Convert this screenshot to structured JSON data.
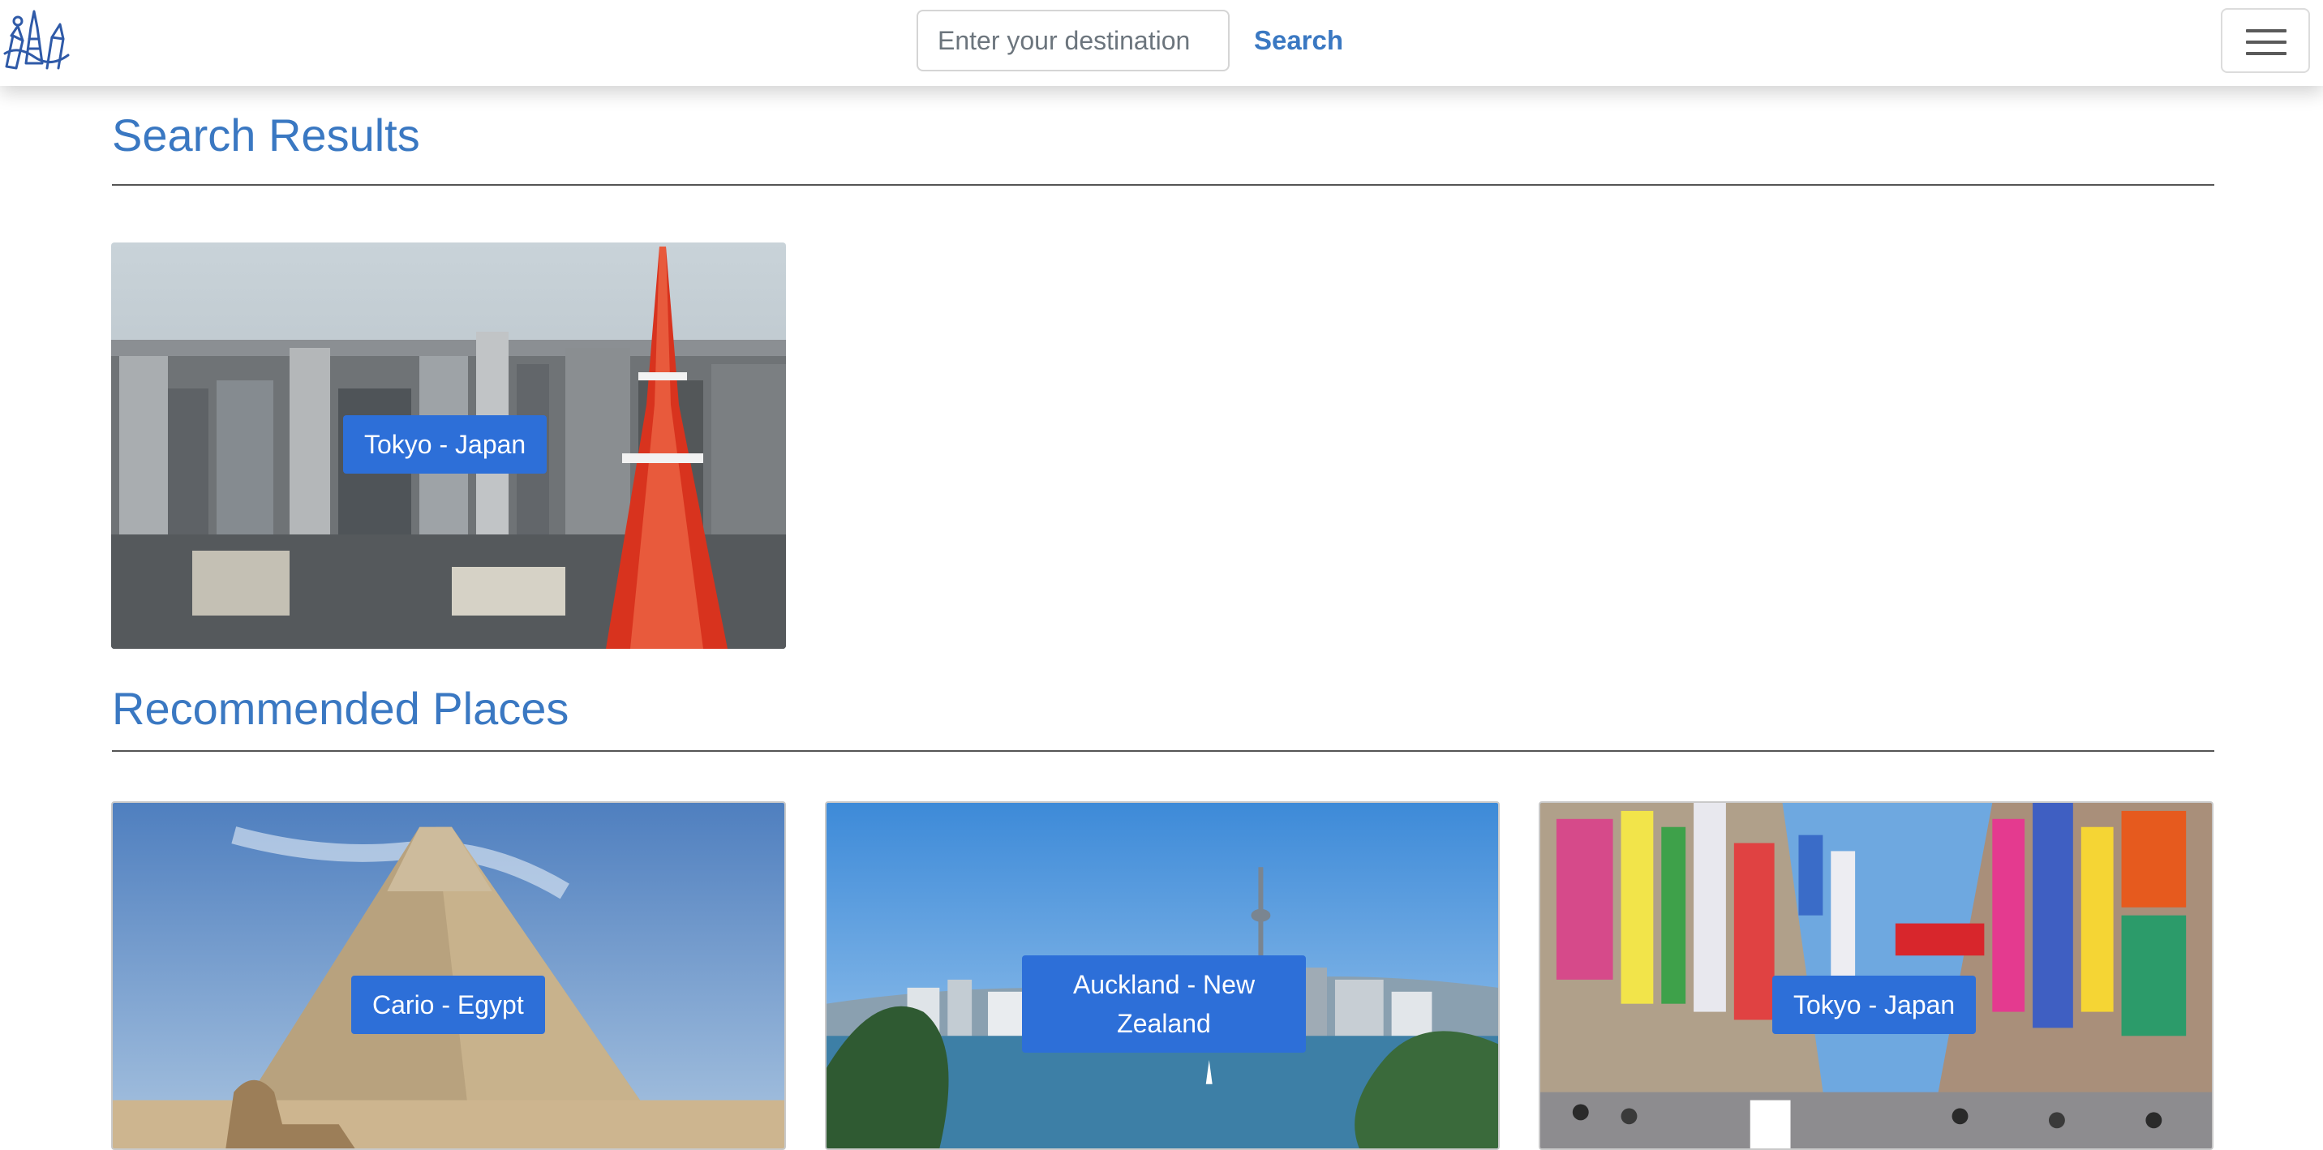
{
  "navbar": {
    "search_placeholder": "Enter your destination",
    "search_value": "",
    "search_button_label": "Search",
    "logo_icon": "landmarks-logo-icon",
    "menu_icon": "hamburger-menu-icon"
  },
  "search_results": {
    "title": "Search Results",
    "items": [
      {
        "label": "Tokyo - Japan",
        "image": "tokyo-tower-cityscape"
      }
    ]
  },
  "recommended": {
    "title": "Recommended Places",
    "items": [
      {
        "label": "Cario - Egypt",
        "image": "pyramid-sphinx"
      },
      {
        "label": "Auckland - New Zealand",
        "image": "auckland-skyline-harbor"
      },
      {
        "label": "Tokyo - Japan",
        "image": "akihabara-street"
      }
    ]
  },
  "colors": {
    "accent": "#3a78c2",
    "label_bg": "#2d6fd8"
  }
}
